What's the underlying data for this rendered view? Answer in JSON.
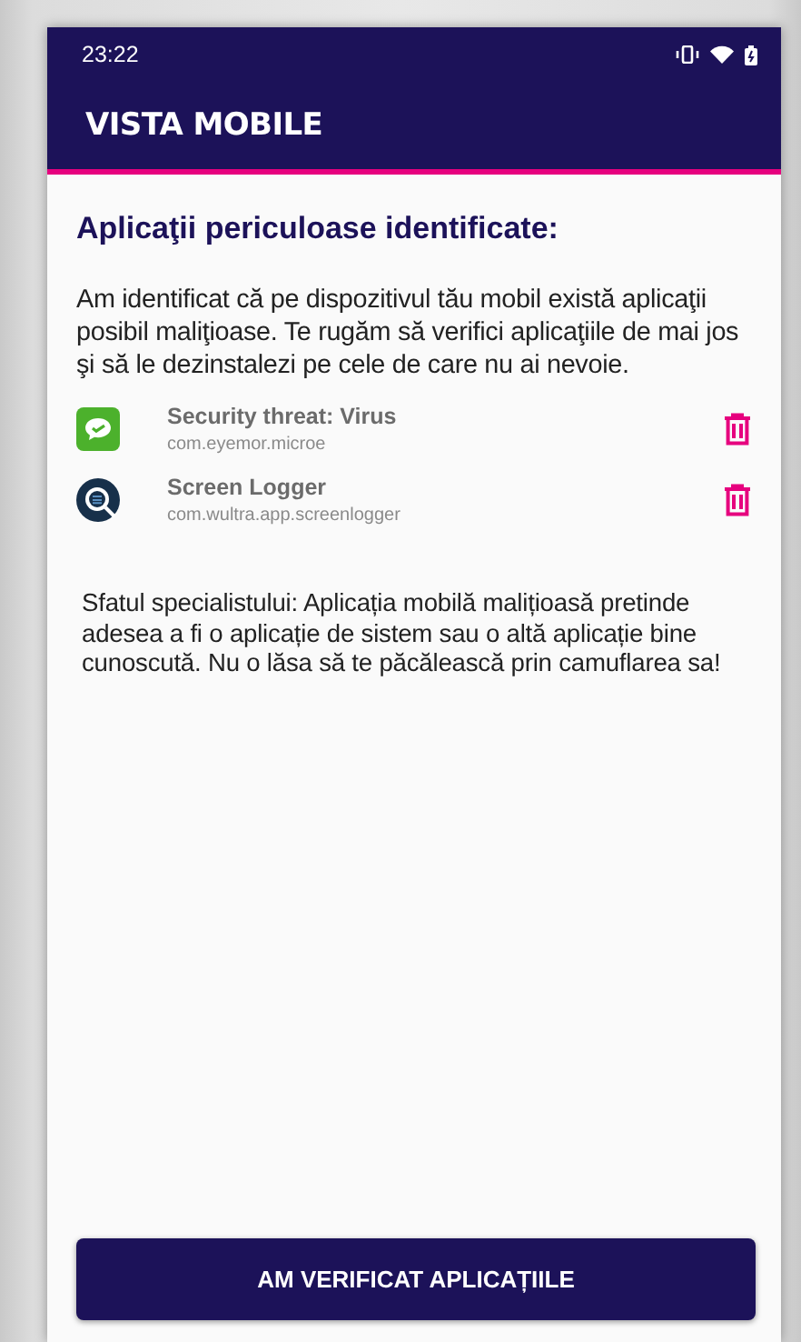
{
  "status_bar": {
    "time": "23:22"
  },
  "app_bar": {
    "title": "VISTA MOBILE"
  },
  "heading": "Aplicaţii periculoase identificate:",
  "intro": "Am identificat că pe dispozitivul tău mobil există aplicaţii posibil maliţioase. Te rugăm să verifici aplicaţiile de mai jos şi să le dezinstalezi pe cele de care nu ai nevoie.",
  "apps": [
    {
      "name": "Security threat: Virus",
      "package": "com.eyemor.microe"
    },
    {
      "name": "Screen Logger",
      "package": "com.wultra.app.screenlogger"
    }
  ],
  "tip": "Sfatul specialistului: Aplicația mobilă malițioasă pretinde adesea a fi o aplicație de sistem sau o altă aplicație bine cunoscută. Nu o lăsa să te păcălească prin camuflarea sa!",
  "button": "AM VERIFICAT APLICAȚIILE"
}
